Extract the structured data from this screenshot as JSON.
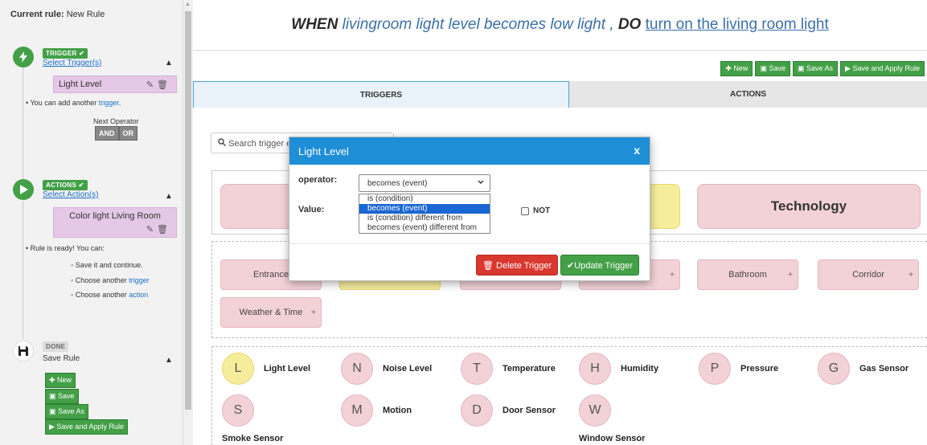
{
  "sidebar": {
    "current_rule_label": "Current rule:",
    "current_rule_name": "New Rule",
    "trigger": {
      "tag": "TRIGGER ✔",
      "link": "Select Trigger(s)",
      "chip": "Light Level",
      "note_prefix": "You can add another",
      "note_link": "trigger",
      "note_suffix": ".",
      "next_operator": "Next Operator",
      "and": "AND",
      "or": "OR"
    },
    "actions": {
      "tag": "ACTIONS ✔",
      "link": "Select Action(s)",
      "chip": "Color light Living Room",
      "ready": "Rule is ready! You can:",
      "opt1": "Save it and continue.",
      "opt2_prefix": "Choose another",
      "opt2_link": "trigger",
      "opt3_prefix": "Choose another",
      "opt3_link": "action"
    },
    "done": {
      "tag": "DONE",
      "label": "Save Rule",
      "new": "New",
      "save": "Save",
      "save_as": "Save As",
      "save_apply": "Save and Apply Rule"
    }
  },
  "headline": {
    "when": "WHEN",
    "condition": "livingroom light level becomes low light ,",
    "do": "DO",
    "action_link": "turn on the living room light"
  },
  "toolbar": {
    "new": "New",
    "save": "Save",
    "save_as": "Save As",
    "save_apply": "Save and Apply Rule"
  },
  "tabs": {
    "triggers": "TRIGGERS",
    "actions": "ACTIONS"
  },
  "search": {
    "placeholder": "Search trigger e"
  },
  "categories": {
    "technology": "Technology"
  },
  "locations": {
    "entrance": "Entrance",
    "bathroom": "Bathroom",
    "corridor": "Corridor",
    "weather": "Weather & Time"
  },
  "sensors": [
    {
      "letter": "L",
      "label": "Light Level"
    },
    {
      "letter": "N",
      "label": "Noise Level"
    },
    {
      "letter": "T",
      "label": "Temperature"
    },
    {
      "letter": "H",
      "label": "Humidity"
    },
    {
      "letter": "P",
      "label": "Pressure"
    },
    {
      "letter": "G",
      "label": "Gas Sensor"
    },
    {
      "letter": "S",
      "label": "Smoke Sensor"
    },
    {
      "letter": "M",
      "label": "Motion"
    },
    {
      "letter": "D",
      "label": "Door Sensor"
    },
    {
      "letter": "W",
      "label": "Window Sensor"
    }
  ],
  "modal": {
    "title": "Light Level",
    "close": "x",
    "operator_label": "operator:",
    "selected_operator": "becomes (event)",
    "options": [
      "is (condition)",
      "becomes (event)",
      "is (condition) different from",
      "becomes (event) different from"
    ],
    "value_label": "Value:",
    "not_label": "NOT",
    "delete": "Delete Trigger",
    "update": "Update Trigger"
  },
  "colors": {
    "accent_blue": "#1e8fd6",
    "success_green": "#43a047",
    "danger_red": "#d9382f",
    "tile_pink": "#f3d2d7",
    "tile_yellow": "#f6ed9c"
  }
}
